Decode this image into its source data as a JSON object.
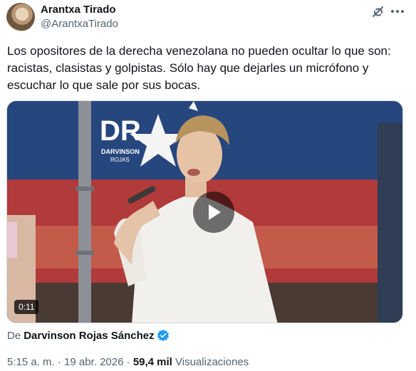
{
  "author": {
    "name": "Arantxa Tirado",
    "handle": "@ArantxaTirado"
  },
  "icons": {
    "grok": "grok-icon",
    "more": "more-horizontal-icon",
    "play": "play-icon",
    "verified": "verified-badge-icon"
  },
  "tweet": {
    "text": "Los opositores de la derecha venezolana no pueden ocultar lo que son:\nracistas, clasistas y golpistas. Sólo hay que dejarles un micrófono y\nescuchar lo que sale por sus bocas."
  },
  "media": {
    "type": "video",
    "duration": "0:11",
    "logo_letters": "DR",
    "logo_line1": "DARVINSON",
    "logo_line2": "ROJAS"
  },
  "attribution": {
    "prefix": "De",
    "source_name": "Darvinson Rojas Sánchez"
  },
  "meta": {
    "time": "5:15 a. m.",
    "separator1": " · ",
    "date": "19 abr. 2026",
    "separator2": " · ",
    "views_count": "59,4 mil",
    "views_label": " Visualizaciones"
  },
  "colors": {
    "text_primary": "#0f1419",
    "text_secondary": "#536471",
    "verified": "#1d9bf0",
    "border": "#cfd9de"
  }
}
